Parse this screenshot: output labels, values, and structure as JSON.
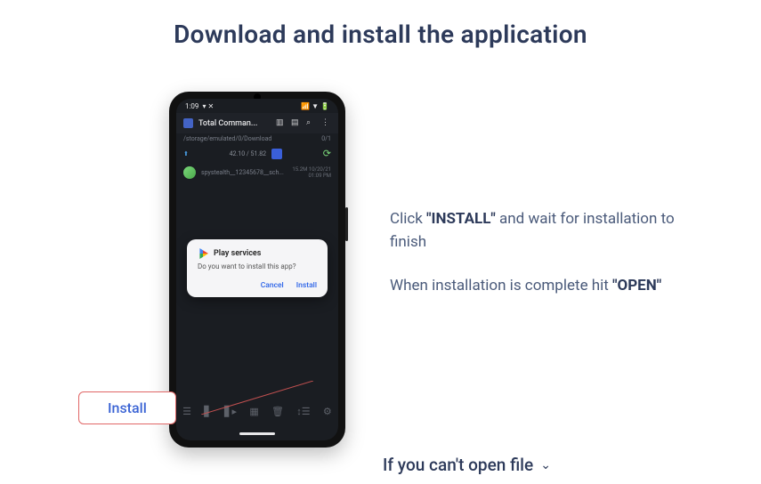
{
  "title": "Download and install the application",
  "phone": {
    "status": {
      "time": "1:09",
      "indicators": "▾ ✕",
      "right": "📶 ▼ 🔋"
    },
    "app_title": "Total Comman...",
    "path": "/storage/emulated/0/Download",
    "path_right": "0/1",
    "size_row": "42.10 / 51.82",
    "file_name": "spystealth__12345678__sch...",
    "file_meta": "15.2M  10/20/21  01:09 PM",
    "dialog": {
      "title": "Play services",
      "body": "Do you want to install this app?",
      "cancel": "Cancel",
      "install": "Install"
    }
  },
  "callout_label": "Install",
  "instructions": {
    "line1_pre": "Click ",
    "line1_bold": "\"INSTALL\"",
    "line1_post": " and wait for installation to finish",
    "line2_pre": "When installation is complete hit ",
    "line2_bold": "\"OPEN\""
  },
  "accordion_label": "If you can't open file"
}
